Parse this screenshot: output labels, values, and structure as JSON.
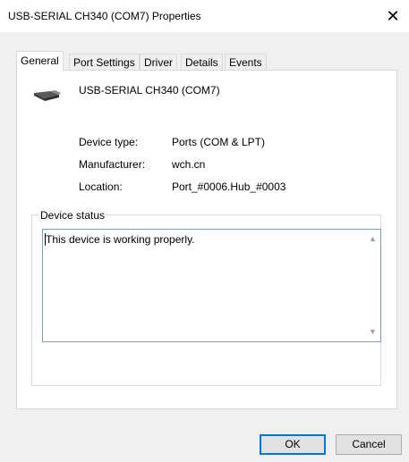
{
  "window": {
    "title": "USB-SERIAL CH340 (COM7) Properties",
    "close_glyph": "✕"
  },
  "tabs": [
    {
      "label": "General",
      "active": true
    },
    {
      "label": "Port Settings"
    },
    {
      "label": "Driver"
    },
    {
      "label": "Details"
    },
    {
      "label": "Events"
    }
  ],
  "device": {
    "name": "USB-SERIAL CH340 (COM7)",
    "icon": "usb-serial-device-icon"
  },
  "info": [
    {
      "label": "Device type:",
      "value": "Ports (COM & LPT)"
    },
    {
      "label": "Manufacturer:",
      "value": "wch.cn"
    },
    {
      "label": "Location:",
      "value": "Port_#0006.Hub_#0003"
    }
  ],
  "status": {
    "legend": "Device status",
    "text": "This device is working properly."
  },
  "buttons": {
    "ok": "OK",
    "cancel": "Cancel"
  },
  "colors": {
    "focus_border": "#0078d7",
    "textbox_border": "#7a9bc8"
  }
}
